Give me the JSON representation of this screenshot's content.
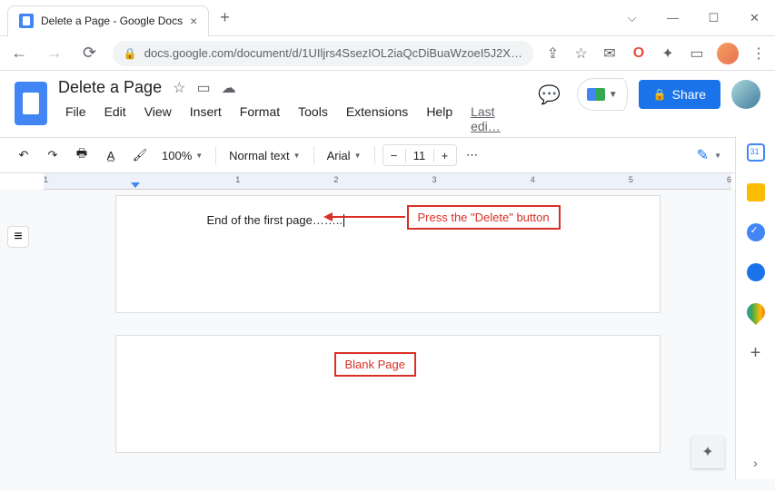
{
  "browser": {
    "tab_title": "Delete a Page - Google Docs",
    "url": "docs.google.com/document/d/1UIljrs4SsezIOL2iaQcDiBuaWzoeI5J2X…",
    "window_controls": {
      "min": "—",
      "max": "☐",
      "close": "✕",
      "caret": "⌵"
    }
  },
  "docs": {
    "title": "Delete a Page",
    "menus": [
      "File",
      "Edit",
      "View",
      "Insert",
      "Format",
      "Tools",
      "Extensions",
      "Help"
    ],
    "last_edit": "Last edi…",
    "share": "Share"
  },
  "toolbar": {
    "zoom": "100%",
    "style": "Normal text",
    "font": "Arial",
    "font_size": "11",
    "minus": "−",
    "plus": "+",
    "more": "⋯"
  },
  "ruler": {
    "nums": [
      "1",
      "",
      "1",
      "2",
      "3",
      "4",
      "5",
      "6"
    ]
  },
  "document": {
    "page1_text": "End of the first page……..",
    "annot1": "Press the \"Delete\" button",
    "annot2": "Blank Page"
  }
}
